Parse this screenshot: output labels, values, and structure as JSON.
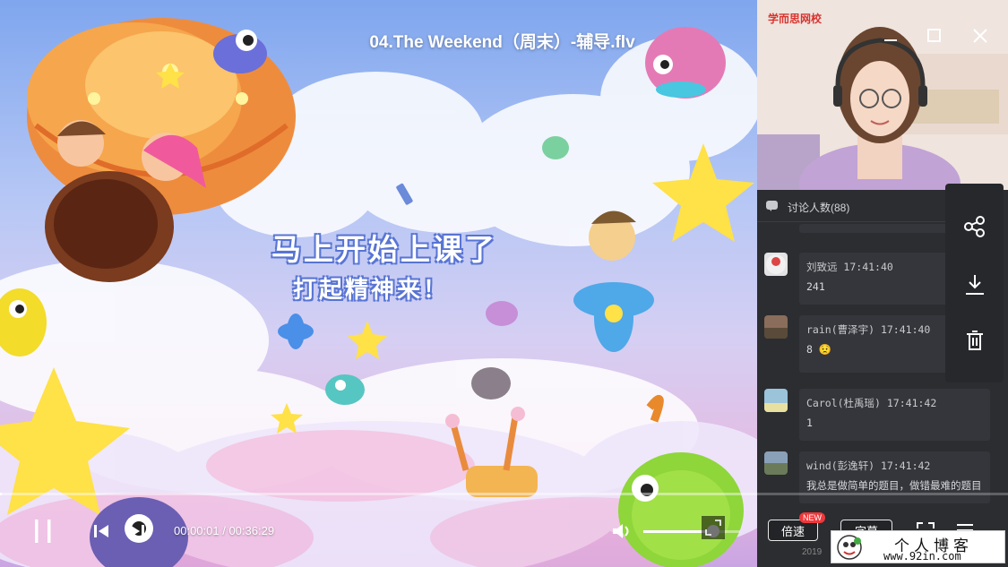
{
  "window": {
    "title": "04.The Weekend（周末）-辅导.flv",
    "buttons": [
      "minimize",
      "maximize",
      "close"
    ]
  },
  "video": {
    "slogan_line1": "马上开始上课了",
    "slogan_line2": "打起精神来！",
    "progress_fraction": 0.001
  },
  "camera": {
    "logo_text": "学而思网校"
  },
  "chat": {
    "header_label": "讨论人数(88)",
    "messages": [
      {
        "meta": "刘致远  17:41:40",
        "text": "241",
        "avatar_color": "#d9d9d9"
      },
      {
        "meta": "rain(曹泽宇)  17:41:40",
        "text": "8 😟",
        "avatar_color": "#8a6d5a"
      },
      {
        "meta": "Carol(杜禹瑶)  17:41:42",
        "text": "1",
        "avatar_color": "#9bc3d9"
      },
      {
        "meta": "wind(彭逸轩)  17:41:42",
        "text": "我总是做简单的题目，做错最难的题目",
        "avatar_color": "#6b7b5a"
      }
    ],
    "cut_text": "2019"
  },
  "side_tools": [
    "share-icon",
    "download-icon",
    "delete-icon"
  ],
  "controls": {
    "time_display": "00:00:01 / 00:36:29",
    "volume_fraction": 0.72,
    "speed_label": "倍速",
    "speed_badge": "NEW",
    "subtitle_label": "字幕"
  },
  "watermark": {
    "title": "个人博客",
    "url": "www.92in.com"
  }
}
